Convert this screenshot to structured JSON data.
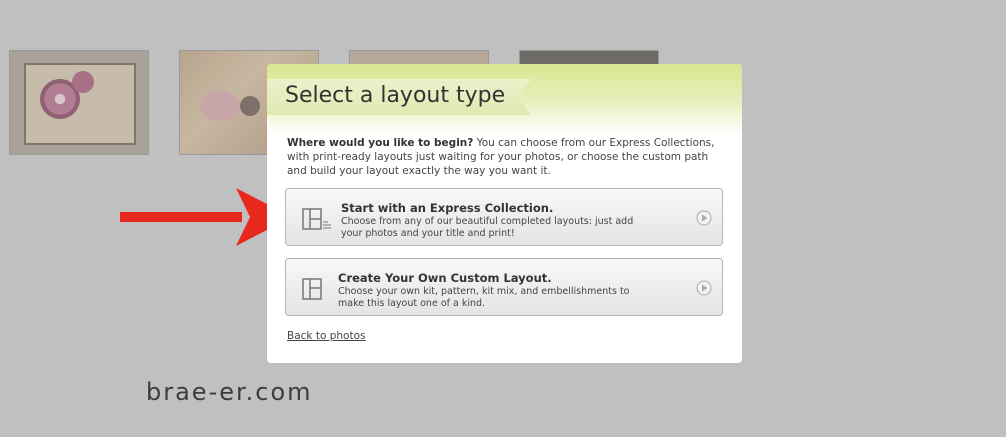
{
  "background": {
    "color": "#c0c0c0"
  },
  "thumbnails": [
    {
      "name": "thumbnail-1"
    },
    {
      "name": "thumbnail-2"
    },
    {
      "name": "thumbnail-3"
    },
    {
      "name": "thumbnail-4"
    }
  ],
  "watermark": "brae-er.com",
  "annotation": {
    "arrow_color": "#e8281c",
    "icon": "red-arrow-icon"
  },
  "dialog": {
    "title": "Select a layout type",
    "header_color": "#d7e78f",
    "intro_bold": "Where would you like to begin?",
    "intro_text": " You can choose from our Express Collections, with print-ready layouts just waiting for your photos, or choose the custom path and build your layout exactly the way you want it.",
    "options": [
      {
        "title": "Start with an Express Collection.",
        "description": "Choose from any of our beautiful completed layouts: just add your photos and your title and print!",
        "icon": "express-layout-icon",
        "action_icon": "play-circle-icon"
      },
      {
        "title": "Create Your Own Custom Layout.",
        "description": "Choose your own kit, pattern, kit mix, and embellishments to make this layout one of a kind.",
        "icon": "custom-layout-icon",
        "action_icon": "play-circle-icon"
      }
    ],
    "back_link": "Back to photos"
  }
}
